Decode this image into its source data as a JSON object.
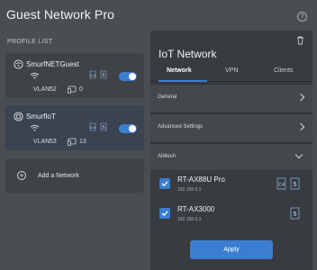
{
  "app": {
    "title": "Guest Network Pro",
    "help_icon": "question-circle-icon"
  },
  "profile_list": {
    "label": "PROFILE LIST",
    "profiles": [
      {
        "name": "SmurfNETGuest",
        "icon": "guest-network-icon",
        "bands": [
          "2.4",
          "5"
        ],
        "enabled": true,
        "vlan_label": "VLAN",
        "vlan": "52",
        "devices": "0"
      },
      {
        "name": "SmurfIoT",
        "icon": "iot-network-icon",
        "bands": [
          "2.4",
          "5"
        ],
        "enabled": true,
        "vlan_label": "VLAN",
        "vlan": "53",
        "devices": "13"
      }
    ],
    "add_label": "Add a Network"
  },
  "panel": {
    "title": "IoT Network",
    "tabs": [
      {
        "label": "Network",
        "active": true
      },
      {
        "label": "VPN",
        "active": false
      },
      {
        "label": "Clients",
        "active": false
      }
    ],
    "sections": [
      {
        "label": "General"
      },
      {
        "label": "Advanced Settings"
      },
      {
        "label": "AiMesh"
      }
    ],
    "nodes": [
      {
        "name": "RT-AX88U Pro",
        "ip": "192.168.9.1",
        "checked": true,
        "bands": [
          "2.4",
          "5"
        ]
      },
      {
        "name": "RT-AX3000",
        "ip": "192.168.9.3",
        "checked": true,
        "bands": [
          "5"
        ]
      }
    ],
    "apply_label": "Apply"
  },
  "colors": {
    "background": "#4a4d52",
    "accent": "#3b7ed1",
    "panel": "#383b40"
  }
}
